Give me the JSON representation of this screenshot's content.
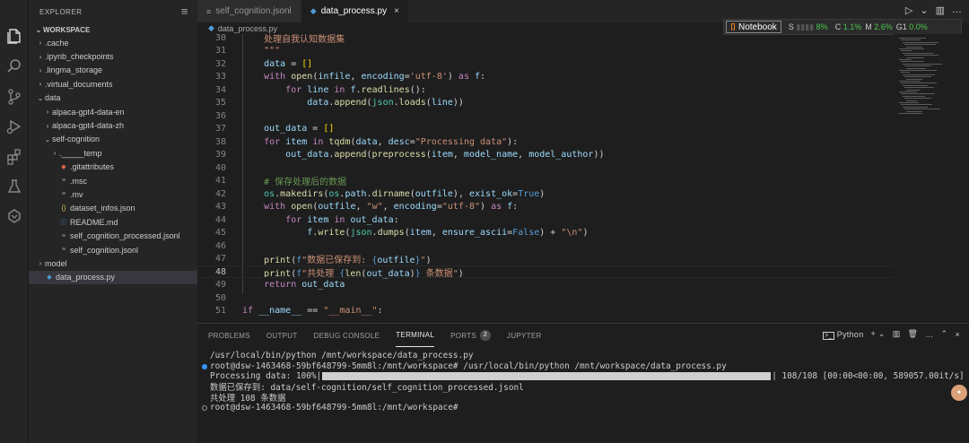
{
  "sidebar": {
    "title": "EXPLORER",
    "workspace": "WORKSPACE",
    "items": [
      {
        "label": ".cache",
        "chev": "›",
        "depth": 1
      },
      {
        "label": ".ipynb_checkpoints",
        "chev": "›",
        "depth": 1
      },
      {
        "label": ".lingma_storage",
        "chev": "›",
        "depth": 1
      },
      {
        "label": ".virtual_documents",
        "chev": "›",
        "depth": 1
      },
      {
        "label": "data",
        "chev": "⌄",
        "depth": 1
      },
      {
        "label": "alpaca-gpt4-data-en",
        "chev": "›",
        "depth": 2
      },
      {
        "label": "alpaca-gpt4-data-zh",
        "chev": "›",
        "depth": 2
      },
      {
        "label": "self-cognition",
        "chev": "⌄",
        "depth": 2
      },
      {
        "label": "._____temp",
        "chev": "›",
        "depth": 3
      },
      {
        "label": ".gitattributes",
        "icon": "◆",
        "iconColor": "#e5684a",
        "depth": 3
      },
      {
        "label": ".msc",
        "icon": "≡",
        "iconColor": "#999999",
        "depth": 3
      },
      {
        "label": ".mv",
        "icon": "≡",
        "iconColor": "#999999",
        "depth": 3
      },
      {
        "label": "dataset_infos.json",
        "icon": "{}",
        "iconColor": "#e8c650",
        "depth": 3
      },
      {
        "label": "README.md",
        "icon": "ⓘ",
        "iconColor": "#4f9bd8",
        "depth": 3
      },
      {
        "label": "self_cognition_processed.jsonl",
        "icon": "≡",
        "iconColor": "#999999",
        "depth": 3
      },
      {
        "label": "self_cognition.jsonl",
        "icon": "≡",
        "iconColor": "#999999",
        "depth": 3
      },
      {
        "label": "model",
        "chev": "›",
        "depth": 1
      },
      {
        "label": "data_process.py",
        "icon": "◆",
        "iconColor": "#4f9bd8",
        "depth": 1,
        "selected": true
      }
    ]
  },
  "tabs": [
    {
      "label": "self_cognition.jsonl",
      "icon": "≡",
      "active": false
    },
    {
      "label": "data_process.py",
      "icon": "◆",
      "active": true
    }
  ],
  "breadcrumb": "data_process.py",
  "widget": {
    "notebook": "Notebook",
    "s_label": "S",
    "s_value": "8%",
    "c_label": "C",
    "c_value": "1.1%",
    "m_label": "M",
    "m_value": "2.6%",
    "g_label": "G1",
    "g_value": "0.0%"
  },
  "code": {
    "current_line": 48,
    "lines": [
      {
        "n": 30,
        "html": "    <span class=\"st\">处理自我认知数据集</span>"
      },
      {
        "n": 31,
        "html": "    <span class=\"st\">\"\"\"</span>"
      },
      {
        "n": 32,
        "html": "    <span class=\"prm\">data</span> = <span class=\"br\">[]</span>"
      },
      {
        "n": 33,
        "html": "    <span class=\"kw\">with</span> <span class=\"fn\">open</span>(<span class=\"prm\">infile</span>, <span class=\"prm\">encoding</span>=<span class=\"st\">'utf-8'</span>) <span class=\"kw\">as</span> <span class=\"prm\">f</span>:"
      },
      {
        "n": 34,
        "html": "        <span class=\"kw\">for</span> <span class=\"prm\">line</span> <span class=\"kw\">in</span> <span class=\"prm\">f</span>.<span class=\"fn\">readlines</span>():"
      },
      {
        "n": 35,
        "html": "            <span class=\"prm\">data</span>.<span class=\"fn\">append</span>(<span class=\"bi\">json</span>.<span class=\"fn\">loads</span>(<span class=\"prm\">line</span>))"
      },
      {
        "n": 36,
        "html": ""
      },
      {
        "n": 37,
        "html": "    <span class=\"prm\">out_data</span> = <span class=\"br\">[]</span>"
      },
      {
        "n": 38,
        "html": "    <span class=\"kw\">for</span> <span class=\"prm\">item</span> <span class=\"kw\">in</span> <span class=\"fn\">tqdm</span>(<span class=\"prm\">data</span>, <span class=\"prm\">desc</span>=<span class=\"st\">\"Processing data\"</span>):"
      },
      {
        "n": 39,
        "html": "        <span class=\"prm\">out_data</span>.<span class=\"fn\">append</span>(<span class=\"fn\">preprocess</span>(<span class=\"prm\">item</span>, <span class=\"prm\">model_name</span>, <span class=\"prm\">model_author</span>))"
      },
      {
        "n": 40,
        "html": ""
      },
      {
        "n": 41,
        "html": "    <span class=\"cm\"># 保存处理后的数据</span>"
      },
      {
        "n": 42,
        "html": "    <span class=\"bi\">os</span>.<span class=\"fn\">makedirs</span>(<span class=\"bi\">os</span>.<span class=\"prm\">path</span>.<span class=\"fn\">dirname</span>(<span class=\"prm\">outfile</span>), <span class=\"prm\">exist_ok</span>=<span class=\"kc\">True</span>)"
      },
      {
        "n": 43,
        "html": "    <span class=\"kw\">with</span> <span class=\"fn\">open</span>(<span class=\"prm\">outfile</span>, <span class=\"st\">\"w\"</span>, <span class=\"prm\">encoding</span>=<span class=\"st\">\"utf-8\"</span>) <span class=\"kw\">as</span> <span class=\"prm\">f</span>:"
      },
      {
        "n": 44,
        "html": "        <span class=\"kw\">for</span> <span class=\"prm\">item</span> <span class=\"kw\">in</span> <span class=\"prm\">out_data</span>:"
      },
      {
        "n": 45,
        "html": "            <span class=\"prm\">f</span>.<span class=\"fn\">write</span>(<span class=\"bi\">json</span>.<span class=\"fn\">dumps</span>(<span class=\"prm\">item</span>, <span class=\"prm\">ensure_ascii</span>=<span class=\"kc\">False</span>) + <span class=\"st\">\"\\n\"</span>)"
      },
      {
        "n": 46,
        "html": ""
      },
      {
        "n": 47,
        "html": "    <span class=\"fn\">print</span>(<span class=\"kc\">f</span><span class=\"st\">\"数据已保存到: </span><span class=\"kc\">{</span><span class=\"prm\">outfile</span><span class=\"kc\">}</span><span class=\"st\">\"</span>)"
      },
      {
        "n": 48,
        "html": "    <span class=\"fn\">print</span>(<span class=\"kc\">f</span><span class=\"st\">\"共处理 </span><span class=\"kc\">{</span><span class=\"fn\">len</span>(<span class=\"prm\">out_data</span>)<span class=\"kc\">}</span><span class=\"st\"> 条数据\"</span>)"
      },
      {
        "n": 49,
        "html": "    <span class=\"kw\">return</span> <span class=\"prm\">out_data</span>"
      },
      {
        "n": 50,
        "html": ""
      },
      {
        "n": 51,
        "html": "<span class=\"kw\">if</span> <span class=\"prm\">__name__</span> == <span class=\"st\">\"__main__\"</span>:"
      }
    ]
  },
  "panel": {
    "tabs": [
      "PROBLEMS",
      "OUTPUT",
      "DEBUG CONSOLE",
      "TERMINAL",
      "PORTS",
      "JUPYTER"
    ],
    "active_tab": "TERMINAL",
    "ports_count": "2",
    "terminal_kind": "Python",
    "terminal": {
      "line1": "/usr/local/bin/python /mnt/workspace/data_process.py",
      "line2": "root@dsw-1463468-59bf648799-5mm8l:/mnt/workspace# /usr/local/bin/python /mnt/workspace/data_process.py",
      "line3_prefix": "Processing data: 100%|",
      "line3_suffix": "| 108/108 [00:00<00:00, 589057.00it/s]",
      "progress": 1.0,
      "line4": "数据已保存到: data/self-cognition/self_cognition_processed.jsonl",
      "line5": "共处理 108 条数据",
      "line6": "root@dsw-1463468-59bf648799-5mm8l:/mnt/workspace#"
    }
  }
}
